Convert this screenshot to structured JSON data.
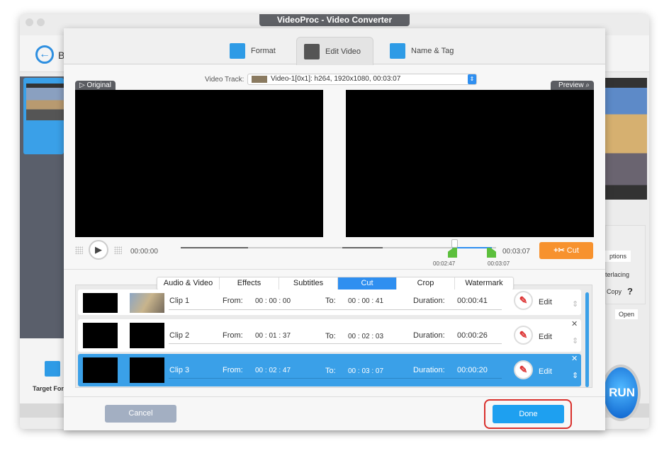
{
  "window": {
    "title": "VideoProc - Video Converter"
  },
  "background_app": {
    "back_label": "B",
    "target_format_label": "Target For",
    "options_label": "ptions",
    "deinterlacing_label": "terlacing",
    "copy_label": "Copy",
    "help": "?",
    "open_label": "Open",
    "run_label": "RUN"
  },
  "main_tabs": [
    {
      "label": "Format"
    },
    {
      "label": "Edit Video",
      "selected": true
    },
    {
      "label": "Name & Tag"
    }
  ],
  "video_track": {
    "label": "Video Track:",
    "value": "Video-1[0x1]: h264, 1920x1080, 00:03:07"
  },
  "original_label": "Original",
  "preview_label": "Preview",
  "player": {
    "current_time": "00:00:00",
    "end_time": "00:03:07",
    "marker_start": "00:02:47",
    "marker_end": "00:03:07",
    "cut_label": "Cut"
  },
  "sub_tabs": [
    {
      "label": "Audio & Video"
    },
    {
      "label": "Effects"
    },
    {
      "label": "Subtitles"
    },
    {
      "label": "Cut",
      "selected": true
    },
    {
      "label": "Crop"
    },
    {
      "label": "Watermark"
    }
  ],
  "clips": [
    {
      "name": "Clip 1",
      "from_label": "From:",
      "from": "00 : 00 : 00",
      "to_label": "To:",
      "to": "00 : 00 : 41",
      "duration_label": "Duration:",
      "duration": "00:00:41",
      "edit": "Edit"
    },
    {
      "name": "Clip 2",
      "from_label": "From:",
      "from": "00 : 01 : 37",
      "to_label": "To:",
      "to": "00 : 02 : 03",
      "duration_label": "Duration:",
      "duration": "00:00:26",
      "edit": "Edit"
    },
    {
      "name": "Clip 3",
      "from_label": "From:",
      "from": "00 : 02 : 47",
      "to_label": "To:",
      "to": "00 : 03 : 07",
      "duration_label": "Duration:",
      "duration": "00:00:20",
      "edit": "Edit",
      "selected": true
    }
  ],
  "footer": {
    "cancel": "Cancel",
    "done": "Done"
  },
  "colors": {
    "accent": "#3aa0e8",
    "cut": "#f7922e",
    "done": "#1ea0f0",
    "highlight": "#d9302c"
  }
}
